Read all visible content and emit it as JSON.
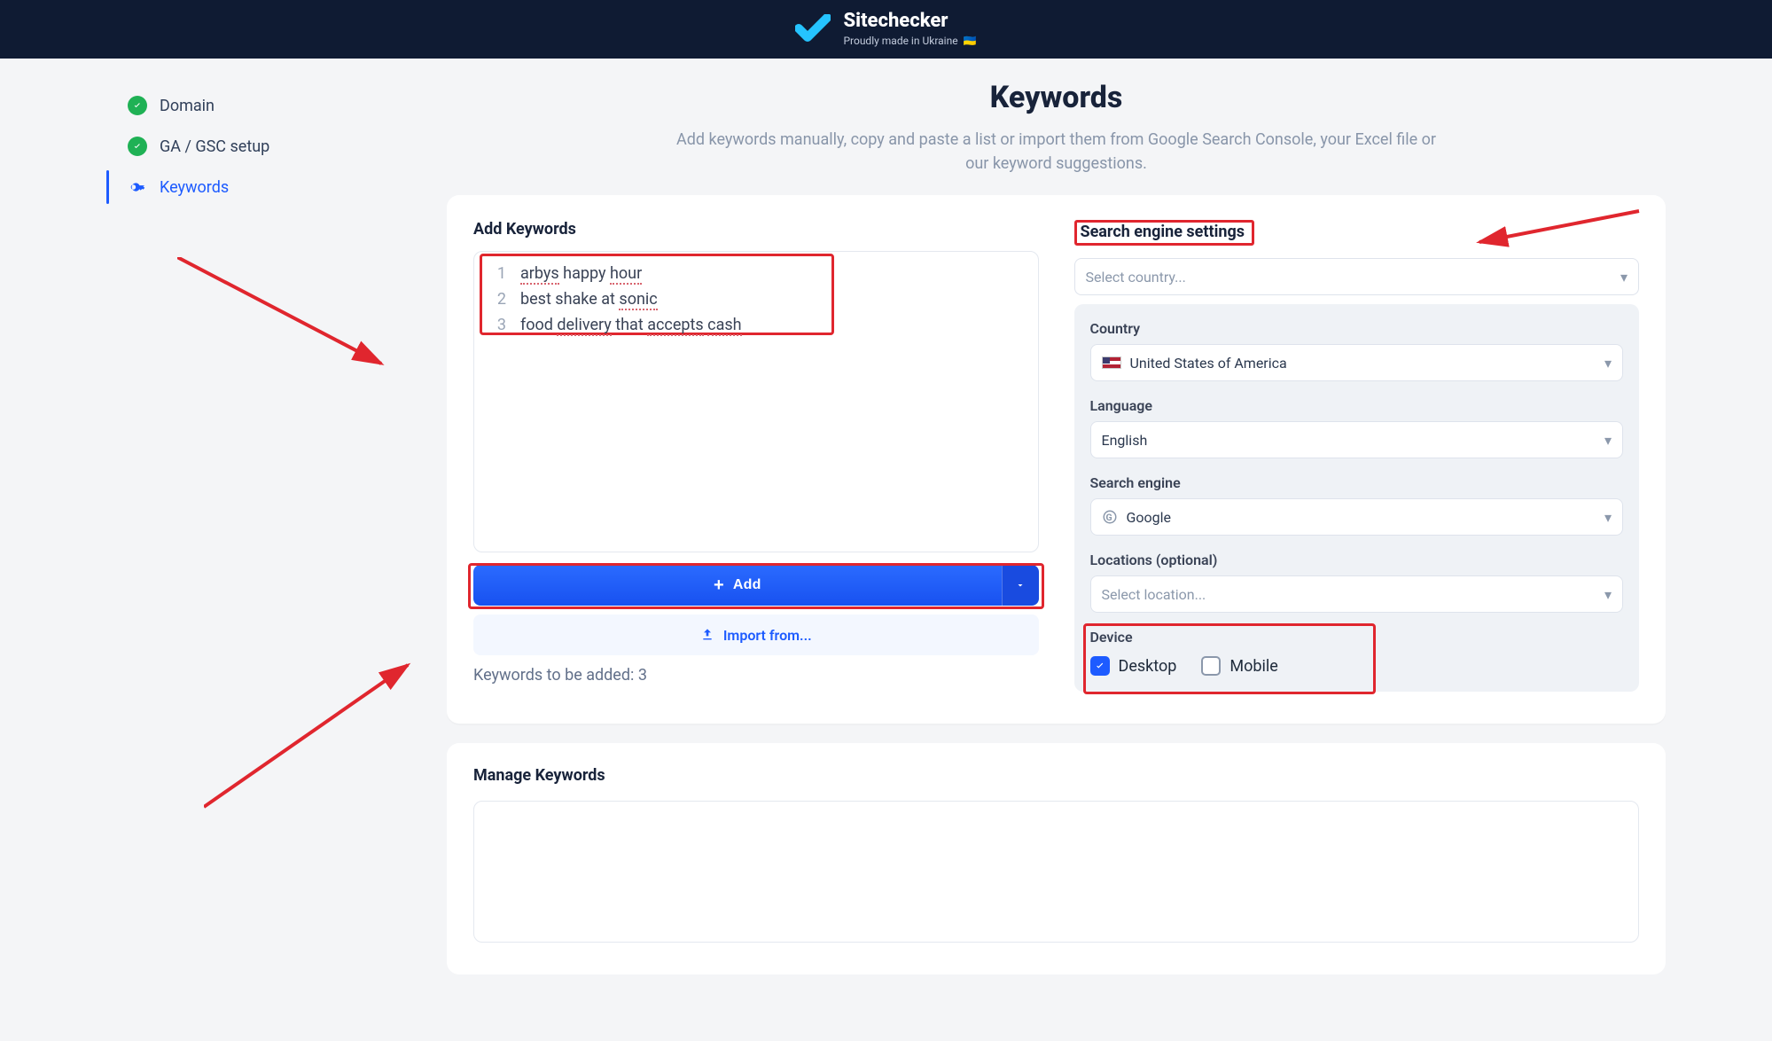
{
  "brand": {
    "title": "Sitechecker",
    "subtitle": "Proudly made in Ukraine",
    "subtitle_flag": "🇺🇦"
  },
  "steps": {
    "domain": "Domain",
    "ga": "GA / GSC setup",
    "keywords": "Keywords"
  },
  "page": {
    "title": "Keywords",
    "subtitle": "Add keywords manually, copy and paste a list or import them from Google Search Console, your Excel file or our keyword suggestions."
  },
  "left": {
    "title": "Add Keywords",
    "lines": [
      {
        "num": "1",
        "pre": "",
        "u1": "arbys",
        "mid": " happy ",
        "u2": "hour"
      },
      {
        "num": "2",
        "pre": "best shake at ",
        "u1": "sonic",
        "mid": "",
        "u2": ""
      },
      {
        "num": "3",
        "pre": "food ",
        "u1": "delivery",
        "mid": " that ",
        "u2": "accepts",
        "mid2": " ",
        "u3": "cash"
      }
    ],
    "add": "Add",
    "import": "Import from...",
    "to_be_added_label": "Keywords to be added: ",
    "to_be_added_count": "3"
  },
  "right": {
    "title": "Search engine settings",
    "country_select_placeholder": "Select country...",
    "country_label": "Country",
    "country_value": "United States of America",
    "language_label": "Language",
    "language_value": "English",
    "search_engine_label": "Search engine",
    "search_engine_value": "Google",
    "locations_label": "Locations (optional)",
    "locations_placeholder": "Select location...",
    "device_label": "Device",
    "desktop": "Desktop",
    "mobile": "Mobile",
    "desktop_checked": true,
    "mobile_checked": false
  },
  "manage": {
    "title": "Manage Keywords"
  }
}
